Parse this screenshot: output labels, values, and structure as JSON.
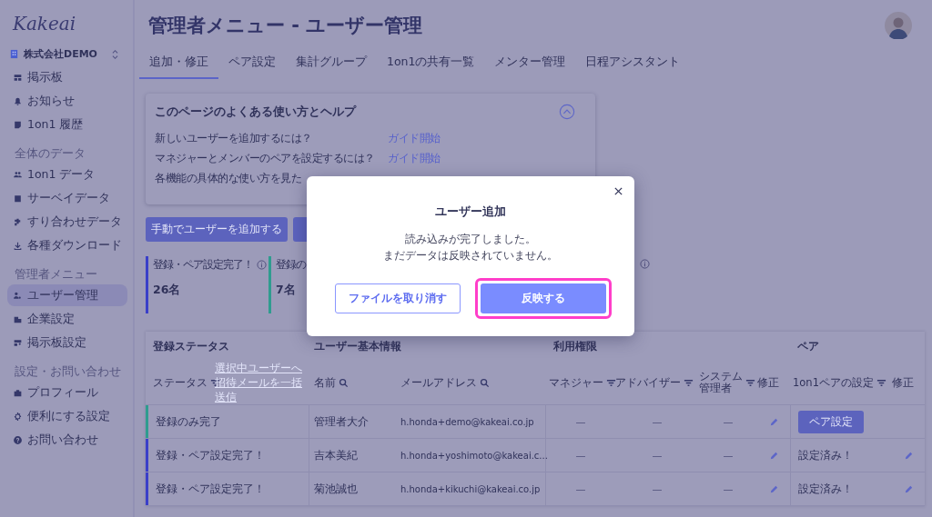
{
  "sidebar": {
    "logo": "Kakeai",
    "company": "株式会社DEMO",
    "sections": [
      {
        "items": [
          {
            "label": "掲示板",
            "selected": false
          },
          {
            "label": "お知らせ",
            "selected": false
          },
          {
            "label": "1on1 履歴",
            "selected": false
          }
        ]
      },
      {
        "heading": "全体のデータ",
        "items": [
          {
            "label": "1on1 データ",
            "selected": false
          },
          {
            "label": "サーベイデータ",
            "selected": false
          },
          {
            "label": "すり合わせデータ",
            "selected": false
          },
          {
            "label": "各種ダウンロード",
            "selected": false
          }
        ]
      },
      {
        "heading": "管理者メニュー",
        "items": [
          {
            "label": "ユーザー管理",
            "selected": true
          },
          {
            "label": "企業設定",
            "selected": false
          },
          {
            "label": "掲示板設定",
            "selected": false
          }
        ]
      },
      {
        "heading": "設定・お問い合わせ",
        "items": [
          {
            "label": "プロフィール",
            "selected": false
          },
          {
            "label": "便利にする設定",
            "selected": false
          },
          {
            "label": "お問い合わせ",
            "selected": false
          }
        ]
      }
    ]
  },
  "page": {
    "title": "管理者メニュー - ユーザー管理"
  },
  "tabs": [
    {
      "label": "追加・修正",
      "selected": true
    },
    {
      "label": "ペア設定",
      "selected": false
    },
    {
      "label": "集計グループ",
      "selected": false
    },
    {
      "label": "1on1の共有一覧",
      "selected": false
    },
    {
      "label": "メンター管理",
      "selected": false
    },
    {
      "label": "日程アシスタント",
      "selected": false
    }
  ],
  "help": {
    "title": "このページのよくある使い方とヘルプ",
    "expanded": true,
    "rows": [
      {
        "question": "新しいユーザーを追加するには？",
        "link": "ガイド開始"
      },
      {
        "question": "マネジャーとメンバーのペアを設定するには？",
        "link": "ガイド開始"
      },
      {
        "question": "各機能の具体的な使い方を見た"
      }
    ]
  },
  "actions": [
    {
      "kind": "button",
      "label": "手動でユーザーを追加する"
    },
    {
      "kind": "button"
    }
  ],
  "stats": [
    {
      "label": "登録・ペア設定完了！",
      "value": "26名",
      "color": "#3a3fc9",
      "info": true
    },
    {
      "label": "登録の",
      "value": "7名",
      "color": "#2f9c8f",
      "info": false
    },
    {
      "info": true
    }
  ],
  "table": {
    "groups": [
      "登録ステータス",
      "ユーザー基本情報",
      "利用権限",
      "ペア"
    ],
    "columns": [
      {
        "label": "ステータス",
        "kind": "filter"
      },
      {
        "label": "選択中ユーザーへ招待メールを一括送信",
        "kind": "link"
      },
      {
        "label": "名前",
        "kind": "search"
      },
      {
        "label": "メールアドレス",
        "kind": "search"
      },
      {
        "label": "マネジャー",
        "kind": "filter"
      },
      {
        "label": "アドバイザー",
        "kind": "filter"
      },
      {
        "label": "システム管理者",
        "kind": "filter"
      },
      {
        "label": "修正",
        "kind": "plain"
      },
      {
        "label": "1on1ペアの設定",
        "kind": "filter"
      },
      {
        "label": "修正",
        "kind": "plain"
      }
    ],
    "rows": [
      {
        "status": "登録のみ完了",
        "color": "#2f9c8f",
        "name": "管理者大介",
        "email": "h.honda+demo@kakeai.co.jp",
        "manager": "—",
        "advisor": "—",
        "admin": "—",
        "pair": {
          "kind": "button",
          "label": "ペア設定",
          "editable": false
        }
      },
      {
        "status": "登録・ペア設定完了！",
        "color": "#3a3fc9",
        "name": "吉本美紀",
        "email": "h.honda+yoshimoto@kakeai.c...",
        "manager": "—",
        "advisor": "—",
        "admin": "—",
        "pair": {
          "kind": "text",
          "label": "設定済み！",
          "editable": true
        }
      },
      {
        "status": "登録・ペア設定完了！",
        "color": "#3a3fc9",
        "name": "菊池誠也",
        "email": "h.honda+kikuchi@kakeai.co.jp",
        "manager": "—",
        "advisor": "—",
        "admin": "—",
        "pair": {
          "kind": "text",
          "label": "設定済み！",
          "editable": true
        }
      }
    ]
  },
  "dialog": {
    "title": "ユーザー追加",
    "message": [
      "読み込みが完了しました。",
      "まだデータは反映されていません。"
    ],
    "buttons": [
      {
        "label": "ファイルを取り消す",
        "kind": "secondary",
        "highlighted": false
      },
      {
        "label": "反映する",
        "kind": "primary",
        "highlighted": true
      }
    ]
  }
}
